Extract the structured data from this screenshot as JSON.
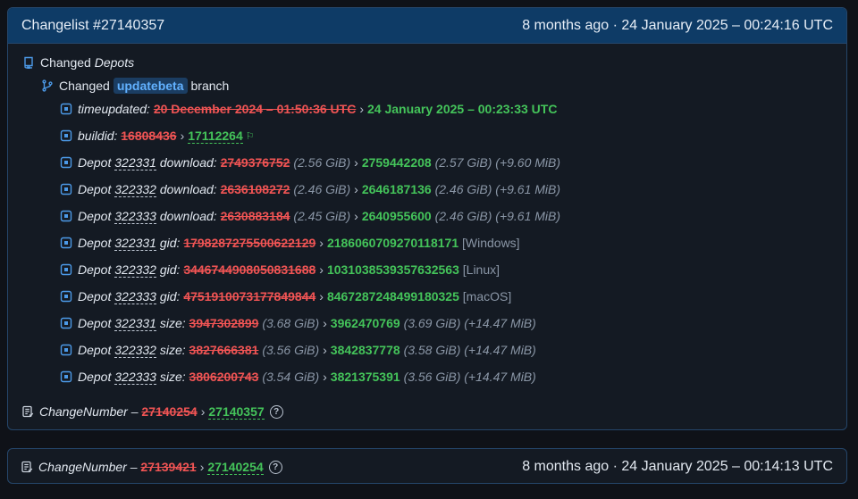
{
  "changelist": {
    "title": "Changelist #27140357",
    "time_ago": "8 months ago",
    "separator": "·",
    "timestamp": "24 January 2025 – 00:24:16 UTC"
  },
  "depots": {
    "changed_label": "Changed",
    "depots_label": "Depots",
    "branch": {
      "changed_label": "Changed",
      "name": "updatebeta",
      "suffix": "branch"
    }
  },
  "changes": [
    {
      "prefix": "timeupdated:",
      "depot": "",
      "field": "",
      "old": "20 December 2024 – 01:50:36 UTC",
      "old_extra": "",
      "new": "24 January 2025 – 00:23:33 UTC",
      "new_extra": "",
      "diff": ""
    },
    {
      "prefix": "buildid:",
      "depot": "",
      "field": "",
      "old": "16808436",
      "old_extra": "",
      "new": "17112264",
      "new_extra": "",
      "diff": ""
    },
    {
      "prefix": "Depot",
      "depot": "322331",
      "field": "download:",
      "old": "2749376752",
      "old_extra": "(2.56 GiB)",
      "new": "2759442208",
      "new_extra": "(2.57 GiB)",
      "diff": "(+9.60 MiB)"
    },
    {
      "prefix": "Depot",
      "depot": "322332",
      "field": "download:",
      "old": "2636108272",
      "old_extra": "(2.46 GiB)",
      "new": "2646187136",
      "new_extra": "(2.46 GiB)",
      "diff": "(+9.61 MiB)"
    },
    {
      "prefix": "Depot",
      "depot": "322333",
      "field": "download:",
      "old": "2630883184",
      "old_extra": "(2.45 GiB)",
      "new": "2640955600",
      "new_extra": "(2.46 GiB)",
      "diff": "(+9.61 MiB)"
    },
    {
      "prefix": "Depot",
      "depot": "322331",
      "field": "gid:",
      "old": "1798287275500622129",
      "old_extra": "",
      "new": "2186060709270118171",
      "new_extra": "[Windows]",
      "diff": ""
    },
    {
      "prefix": "Depot",
      "depot": "322332",
      "field": "gid:",
      "old": "3446744908050831688",
      "old_extra": "",
      "new": "1031038539357632563",
      "new_extra": "[Linux]",
      "diff": ""
    },
    {
      "prefix": "Depot",
      "depot": "322333",
      "field": "gid:",
      "old": "4751910073177849844",
      "old_extra": "",
      "new": "8467287248499180325",
      "new_extra": "[macOS]",
      "diff": ""
    },
    {
      "prefix": "Depot",
      "depot": "322331",
      "field": "size:",
      "old": "3947302899",
      "old_extra": "(3.68 GiB)",
      "new": "3962470769",
      "new_extra": "(3.69 GiB)",
      "diff": "(+14.47 MiB)"
    },
    {
      "prefix": "Depot",
      "depot": "322332",
      "field": "size:",
      "old": "3827666381",
      "old_extra": "(3.56 GiB)",
      "new": "3842837778",
      "new_extra": "(3.58 GiB)",
      "diff": "(+14.47 MiB)"
    },
    {
      "prefix": "Depot",
      "depot": "322333",
      "field": "size:",
      "old": "3806200743",
      "old_extra": "(3.54 GiB)",
      "new": "3821375391",
      "new_extra": "(3.56 GiB)",
      "diff": "(+14.47 MiB)"
    }
  ],
  "change_number": {
    "label": "ChangeNumber –",
    "old": "27140254",
    "new": "27140357",
    "help": "?"
  },
  "secondary": {
    "label": "ChangeNumber –",
    "old": "27139421",
    "new": "27140254",
    "help": "?",
    "time_ago": "8 months ago",
    "separator": "·",
    "timestamp": "24 January 2025 – 00:14:13 UTC"
  },
  "colors": {
    "header_bg": "#0e3b66",
    "old_value": "#f05454",
    "new_value": "#44c45a",
    "accent": "#4c9ae8"
  }
}
